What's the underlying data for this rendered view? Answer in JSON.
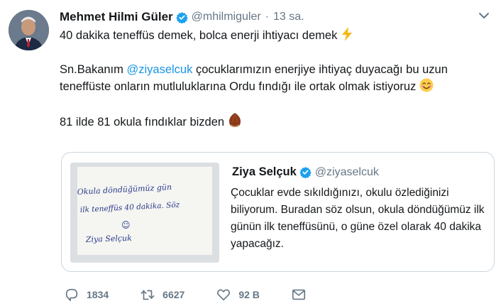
{
  "tweet": {
    "author_name": "Mehmet Hilmi Güler",
    "handle": "@mhilmiguler",
    "separator": "·",
    "time": "13 sa.",
    "line1": "40 dakika teneffüs demek, bolca enerji ihtiyacı demek",
    "line2_prefix": "Sn.Bakanım",
    "line2_mention": "@ziyaselcuk",
    "line2_suffix": " çocuklarımızın enerjiye ihtiyaç duyacağı bu uzun teneffüste onların mutluluklarına Ordu fındığı ile ortak olmak istiyoruz",
    "line3": "81 ilde 81 okula fındıklar bizden",
    "icons": [
      "verified-badge-icon",
      "chevron-down-icon",
      "lightning-emoji",
      "smiling-face-emoji",
      "hazelnut-emoji"
    ]
  },
  "quote": {
    "author_name": "Ziya Selçuk",
    "handle": "@ziyaselcuk",
    "text": "Çocuklar evde sıkıldığınızı, okulu özlediğinizi biliyorum. Buradan söz olsun, okula döndüğümüz ilk günün ilk teneffüsünü, o güne özel olarak 40 dakika yapacağız.",
    "note_line1": "Okula döndüğümüz gün",
    "note_line2": "ilk teneffüs 40 dakika. Söz",
    "note_smiley": "☺",
    "note_signature": "Ziya Selçuk"
  },
  "actions": {
    "reply_count": "1834",
    "retweet_count": "6627",
    "like_count": "92 B"
  },
  "colors": {
    "link": "#1b95e0",
    "secondary": "#657786",
    "verified": "#1da1f2",
    "border": "#ccd6dd"
  }
}
